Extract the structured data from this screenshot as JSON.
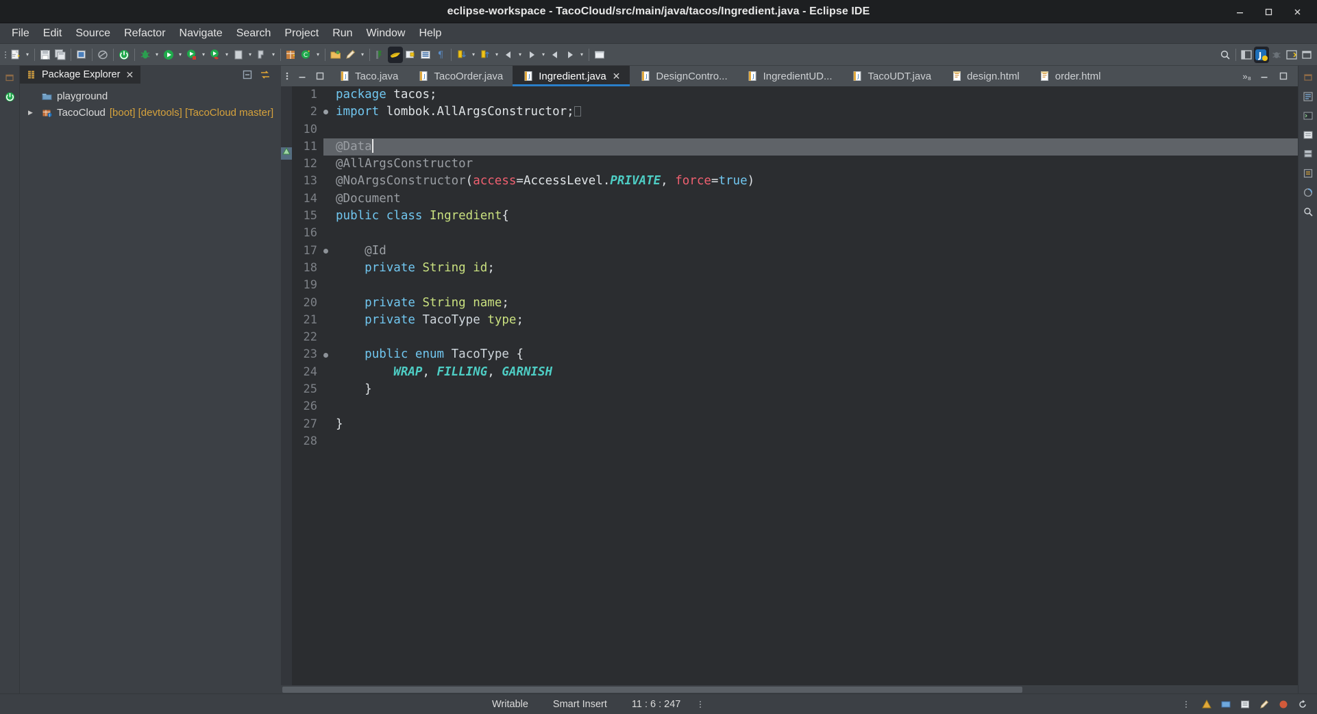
{
  "window": {
    "title": "eclipse-workspace - TacoCloud/src/main/java/tacos/Ingredient.java - Eclipse IDE",
    "minimize_label": "–",
    "maximize_label": "❐",
    "close_label": "✕"
  },
  "menubar": {
    "items": [
      {
        "label": "File"
      },
      {
        "label": "Edit"
      },
      {
        "label": "Source"
      },
      {
        "label": "Refactor"
      },
      {
        "label": "Navigate"
      },
      {
        "label": "Search"
      },
      {
        "label": "Project"
      },
      {
        "label": "Run"
      },
      {
        "label": "Window"
      },
      {
        "label": "Help"
      }
    ]
  },
  "toolbar": {
    "icons": [
      "new-wizard-icon",
      "save-icon",
      "save-all-icon",
      "print-icon",
      "link-icon",
      "terminate-icon",
      "debug-icon",
      "run-icon",
      "run-external-icon",
      "coverage-icon",
      "stop-icon",
      "skip-breakpoints-icon",
      "new-java-project-icon",
      "new-class-icon",
      "open-type-icon",
      "pencil-icon",
      "search-decl-icon",
      "java-perspective-icon",
      "open-task-icon",
      "toggle-markers-icon",
      "pilcrow-icon",
      "next-annotation-icon",
      "previous-annotation-icon",
      "back-icon",
      "forward-icon",
      "jump-icon",
      "folder-icon"
    ],
    "search_icon": "search-icon",
    "right_icons": [
      "panel-icon",
      "java-perspective-badge-icon",
      "debug-perspective-icon",
      "open-perspective-icon",
      "restore-icon"
    ]
  },
  "left_rail": {
    "icons": [
      "restore-view-icon",
      "terminate-all-icon"
    ]
  },
  "explorer": {
    "tab_label": "Package Explorer",
    "tab_close": "✕",
    "tab_icon": "package-explorer-icon",
    "minimize_icon": "minimize-icon",
    "maximize_icon": "maximize-icon",
    "menu_icon": "view-menu-icon",
    "link_icon": "link-with-editor-icon",
    "collapse_icon": "collapse-all-icon",
    "tree": [
      {
        "label": "playground",
        "icon": "project-folder-icon",
        "expanded": false,
        "twisty": "",
        "suffix": ""
      },
      {
        "label": "TacoCloud",
        "icon": "java-project-icon",
        "expanded": false,
        "twisty": "▶",
        "suffix": "[boot] [devtools] [TacoCloud master]"
      }
    ]
  },
  "editor": {
    "tabs": [
      {
        "label": "Taco.java",
        "icon": "java-file-icon",
        "active": false,
        "closable": false
      },
      {
        "label": "TacoOrder.java",
        "icon": "java-file-icon",
        "active": false,
        "closable": false
      },
      {
        "label": "Ingredient.java",
        "icon": "java-file-icon",
        "active": true,
        "closable": true,
        "close": "✕"
      },
      {
        "label": "DesignContro...",
        "icon": "java-file-icon",
        "active": false,
        "closable": false
      },
      {
        "label": "IngredientUD...",
        "icon": "java-file-icon",
        "active": false,
        "closable": false
      },
      {
        "label": "TacoUDT.java",
        "icon": "java-file-icon",
        "active": false,
        "closable": false
      },
      {
        "label": "design.html",
        "icon": "html-file-icon",
        "active": false,
        "closable": false
      },
      {
        "label": "order.html",
        "icon": "html-file-icon",
        "active": false,
        "closable": false
      }
    ],
    "overflow_label": "»₈",
    "minimize_icon": "minimize-icon",
    "maximize_icon": "maximize-icon",
    "code": [
      {
        "number": "1",
        "marker": "",
        "current": false,
        "tokens": [
          {
            "t": "package",
            "c": "k"
          },
          {
            "t": " tacos;",
            "c": "pl"
          }
        ]
      },
      {
        "number": "2",
        "marker": "plus",
        "current": false,
        "tokens": [
          {
            "t": "import",
            "c": "k"
          },
          {
            "t": " lombok.AllArgsConstructor;",
            "c": "pl"
          },
          {
            "t": "□",
            "c": "wsbox"
          }
        ]
      },
      {
        "number": "10",
        "marker": "",
        "current": false,
        "tokens": []
      },
      {
        "number": "11",
        "marker": "warning",
        "current": true,
        "tokens": [
          {
            "t": "@Data",
            "c": "an"
          },
          {
            "t": "|caret|",
            "c": "caret"
          }
        ]
      },
      {
        "number": "12",
        "marker": "",
        "current": false,
        "tokens": [
          {
            "t": "@AllArgsConstructor",
            "c": "an"
          }
        ]
      },
      {
        "number": "13",
        "marker": "",
        "current": false,
        "tokens": [
          {
            "t": "@NoArgsConstructor",
            "c": "an"
          },
          {
            "t": "(",
            "c": "pl"
          },
          {
            "t": "access",
            "c": "par"
          },
          {
            "t": "=AccessLevel.",
            "c": "pl"
          },
          {
            "t": "PRIVATE",
            "c": "en"
          },
          {
            "t": ", ",
            "c": "pl"
          },
          {
            "t": "force",
            "c": "par"
          },
          {
            "t": "=",
            "c": "pl"
          },
          {
            "t": "true",
            "c": "k"
          },
          {
            "t": ")",
            "c": "pl"
          }
        ]
      },
      {
        "number": "14",
        "marker": "",
        "current": false,
        "tokens": [
          {
            "t": "@Document",
            "c": "an"
          }
        ]
      },
      {
        "number": "15",
        "marker": "",
        "current": false,
        "tokens": [
          {
            "t": "public",
            "c": "k"
          },
          {
            "t": " ",
            "c": "pl"
          },
          {
            "t": "class",
            "c": "k"
          },
          {
            "t": " ",
            "c": "pl"
          },
          {
            "t": "Ingredient",
            "c": "cls"
          },
          {
            "t": "{",
            "c": "pl"
          }
        ]
      },
      {
        "number": "16",
        "marker": "",
        "current": false,
        "tokens": []
      },
      {
        "number": "17",
        "marker": "dot",
        "current": false,
        "tokens": [
          {
            "t": "    @Id",
            "c": "an"
          }
        ]
      },
      {
        "number": "18",
        "marker": "",
        "current": false,
        "tokens": [
          {
            "t": "    ",
            "c": "pl"
          },
          {
            "t": "private",
            "c": "k"
          },
          {
            "t": " ",
            "c": "pl"
          },
          {
            "t": "String",
            "c": "cls"
          },
          {
            "t": " ",
            "c": "pl"
          },
          {
            "t": "id",
            "c": "fld"
          },
          {
            "t": ";",
            "c": "pl"
          }
        ]
      },
      {
        "number": "19",
        "marker": "",
        "current": false,
        "tokens": []
      },
      {
        "number": "20",
        "marker": "",
        "current": false,
        "tokens": [
          {
            "t": "    ",
            "c": "pl"
          },
          {
            "t": "private",
            "c": "k"
          },
          {
            "t": " ",
            "c": "pl"
          },
          {
            "t": "String",
            "c": "cls"
          },
          {
            "t": " ",
            "c": "pl"
          },
          {
            "t": "name",
            "c": "fld"
          },
          {
            "t": ";",
            "c": "pl"
          }
        ]
      },
      {
        "number": "21",
        "marker": "",
        "current": false,
        "tokens": [
          {
            "t": "    ",
            "c": "pl"
          },
          {
            "t": "private",
            "c": "k"
          },
          {
            "t": " ",
            "c": "pl"
          },
          {
            "t": "TacoType",
            "c": "ty"
          },
          {
            "t": " ",
            "c": "pl"
          },
          {
            "t": "type",
            "c": "fld"
          },
          {
            "t": ";",
            "c": "pl"
          }
        ]
      },
      {
        "number": "22",
        "marker": "",
        "current": false,
        "tokens": []
      },
      {
        "number": "23",
        "marker": "dot",
        "current": false,
        "tokens": [
          {
            "t": "    ",
            "c": "pl"
          },
          {
            "t": "public",
            "c": "k"
          },
          {
            "t": " ",
            "c": "pl"
          },
          {
            "t": "enum",
            "c": "k"
          },
          {
            "t": " ",
            "c": "pl"
          },
          {
            "t": "TacoType",
            "c": "ty"
          },
          {
            "t": " {",
            "c": "pl"
          }
        ]
      },
      {
        "number": "24",
        "marker": "",
        "current": false,
        "tokens": [
          {
            "t": "        ",
            "c": "pl"
          },
          {
            "t": "WRAP",
            "c": "en"
          },
          {
            "t": ", ",
            "c": "pl"
          },
          {
            "t": "FILLING",
            "c": "en"
          },
          {
            "t": ", ",
            "c": "pl"
          },
          {
            "t": "GARNISH",
            "c": "en"
          }
        ]
      },
      {
        "number": "25",
        "marker": "",
        "current": false,
        "tokens": [
          {
            "t": "    }",
            "c": "pl"
          }
        ]
      },
      {
        "number": "26",
        "marker": "",
        "current": false,
        "tokens": []
      },
      {
        "number": "27",
        "marker": "",
        "current": false,
        "tokens": [
          {
            "t": "}",
            "c": "pl"
          }
        ]
      },
      {
        "number": "28",
        "marker": "",
        "current": false,
        "tokens": []
      }
    ]
  },
  "right_rail": {
    "icons": [
      "outline-icon",
      "console-icon",
      "problems-icon",
      "servers-icon",
      "properties-icon",
      "progress-icon",
      "search-view-icon"
    ]
  },
  "statusbar": {
    "writable": "Writable",
    "insert_mode": "Smart Insert",
    "position": "11 : 6 : 247",
    "menu_icon": "status-menu-icon",
    "right_icons": [
      "dots-icon",
      "warning-icon",
      "build-icon",
      "tasks-icon",
      "edit-icon",
      "heap-icon",
      "refresh-icon"
    ]
  },
  "colors": {
    "accent": "#2a7fc9",
    "titlebar_bg": "#1d1f21",
    "chrome_bg": "#3c4045",
    "toolbar_bg": "#4a4f54",
    "editor_bg": "#2b2d30",
    "current_line": "#5f6368",
    "keyword": "#71c7f0",
    "annotation": "#9a9ea3",
    "class_name": "#c9e07f",
    "parameter": "#ef6070",
    "enum_const": "#4ecdc4"
  }
}
